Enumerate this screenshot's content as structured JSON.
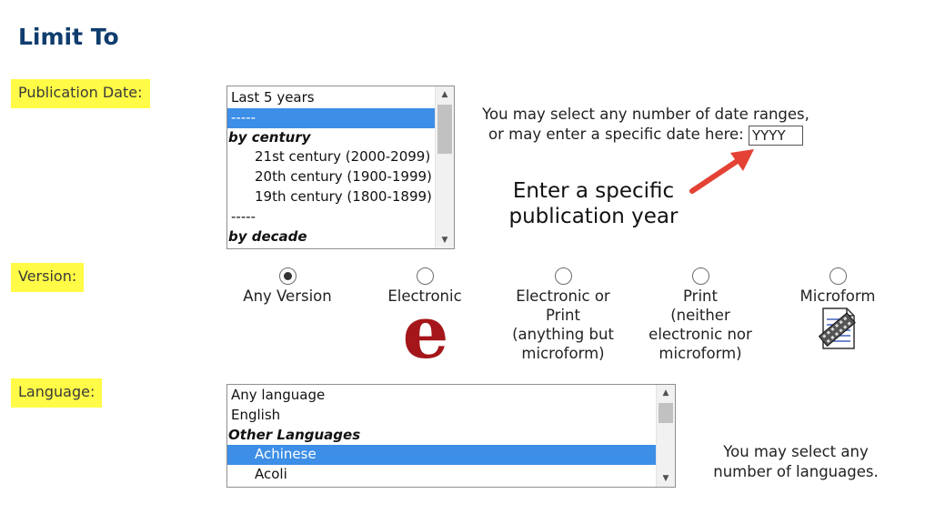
{
  "heading": "Limit To",
  "publication_date": {
    "label": "Publication Date:",
    "options": [
      {
        "text": "Last 5 years",
        "kind": "normal"
      },
      {
        "text": "-----",
        "kind": "selected"
      },
      {
        "text": "by century",
        "kind": "group"
      },
      {
        "text": "21st century (2000-2099)",
        "kind": "indent"
      },
      {
        "text": "20th century (1900-1999)",
        "kind": "indent"
      },
      {
        "text": "19th century (1800-1899)",
        "kind": "indent"
      },
      {
        "text": "-----",
        "kind": "normal"
      },
      {
        "text": "by decade",
        "kind": "group"
      }
    ],
    "help_line1": "You may select any number of date ranges,",
    "help_line2": "or may enter a specific date here:",
    "date_input_value": "YYYY",
    "annotation_line1": "Enter a specific",
    "annotation_line2": "publication year",
    "annotation_arrow_color": "#e34234"
  },
  "version": {
    "label": "Version:",
    "options": [
      {
        "lines": [
          "Any Version"
        ],
        "checked": true,
        "icon": ""
      },
      {
        "lines": [
          "Electronic"
        ],
        "checked": false,
        "icon": "electronic-e-icon"
      },
      {
        "lines": [
          "Electronic or",
          "Print",
          "(anything but",
          "microform)"
        ],
        "checked": false,
        "icon": ""
      },
      {
        "lines": [
          "Print",
          "(neither",
          "electronic nor",
          "microform)"
        ],
        "checked": false,
        "icon": ""
      },
      {
        "lines": [
          "Microform"
        ],
        "checked": false,
        "icon": "microform-icon"
      }
    ],
    "electronic_icon_glyph": "e"
  },
  "language": {
    "label": "Language:",
    "options": [
      {
        "text": "Any language",
        "kind": "normal"
      },
      {
        "text": "English",
        "kind": "normal"
      },
      {
        "text": "Other Languages",
        "kind": "group"
      },
      {
        "text": "Achinese",
        "kind": "selected-indent"
      },
      {
        "text": "Acoli",
        "kind": "indent"
      }
    ],
    "help_line1": "You may select any",
    "help_line2": "number of languages."
  },
  "colors": {
    "heading": "#0f3d6e",
    "label_highlight": "#fffb46",
    "selection": "#3c8ee6",
    "e_logo": "#a4161a"
  }
}
